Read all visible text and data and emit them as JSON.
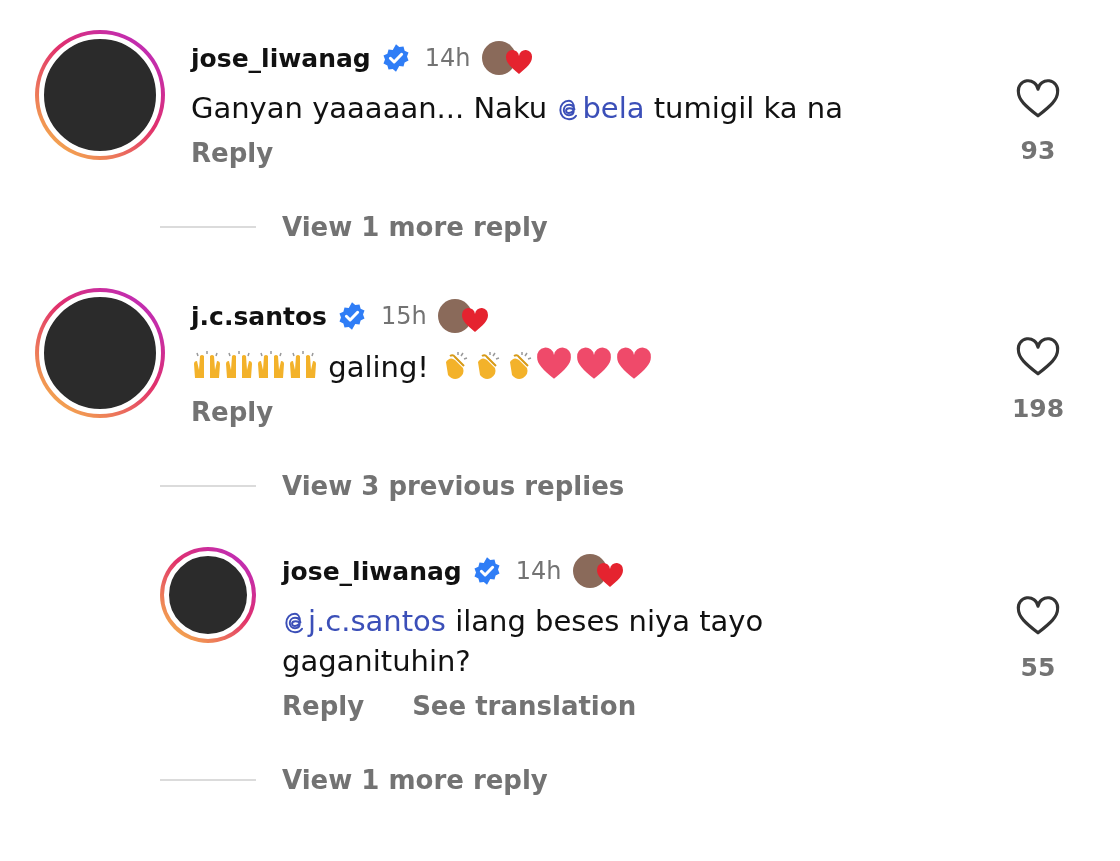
{
  "items": [
    {
      "kind": "comment",
      "nested": false,
      "username": "jose_liwanag",
      "verified": true,
      "time": "14h",
      "liked_by_creator": true,
      "text": [
        {
          "kind": "text",
          "text": "Ganyan yaaaaan... Naku "
        },
        {
          "kind": "mention",
          "text": "bela"
        },
        {
          "kind": "text",
          "text": " tumigil ka na"
        }
      ],
      "actions": [
        "Reply"
      ],
      "liked": false,
      "likes": "93"
    },
    {
      "kind": "link",
      "text": "View 1 more reply"
    },
    {
      "kind": "comment",
      "nested": false,
      "username": "j.c.santos",
      "verified": true,
      "time": "15h",
      "liked_by_creator": true,
      "text": [
        {
          "kind": "raised-hands"
        },
        {
          "kind": "raised-hands"
        },
        {
          "kind": "raised-hands"
        },
        {
          "kind": "raised-hands"
        },
        {
          "kind": "text",
          "text": " galing! "
        },
        {
          "kind": "clap"
        },
        {
          "kind": "clap"
        },
        {
          "kind": "clap"
        },
        {
          "kind": "heart"
        },
        {
          "kind": "heart"
        },
        {
          "kind": "heart"
        }
      ],
      "actions": [
        "Reply"
      ],
      "liked": false,
      "likes": "198"
    },
    {
      "kind": "link",
      "text": "View 3 previous replies"
    },
    {
      "kind": "comment",
      "nested": true,
      "username": "jose_liwanag",
      "verified": true,
      "time": "14h",
      "liked_by_creator": true,
      "text": [
        {
          "kind": "mention",
          "text": "j.c.santos"
        },
        {
          "kind": "text",
          "text": " ilang beses niya tayo gaganituhin?"
        }
      ],
      "actions": [
        "Reply",
        "See translation"
      ],
      "liked": false,
      "likes": "55"
    },
    {
      "kind": "link",
      "text": "View 1 more reply"
    }
  ]
}
